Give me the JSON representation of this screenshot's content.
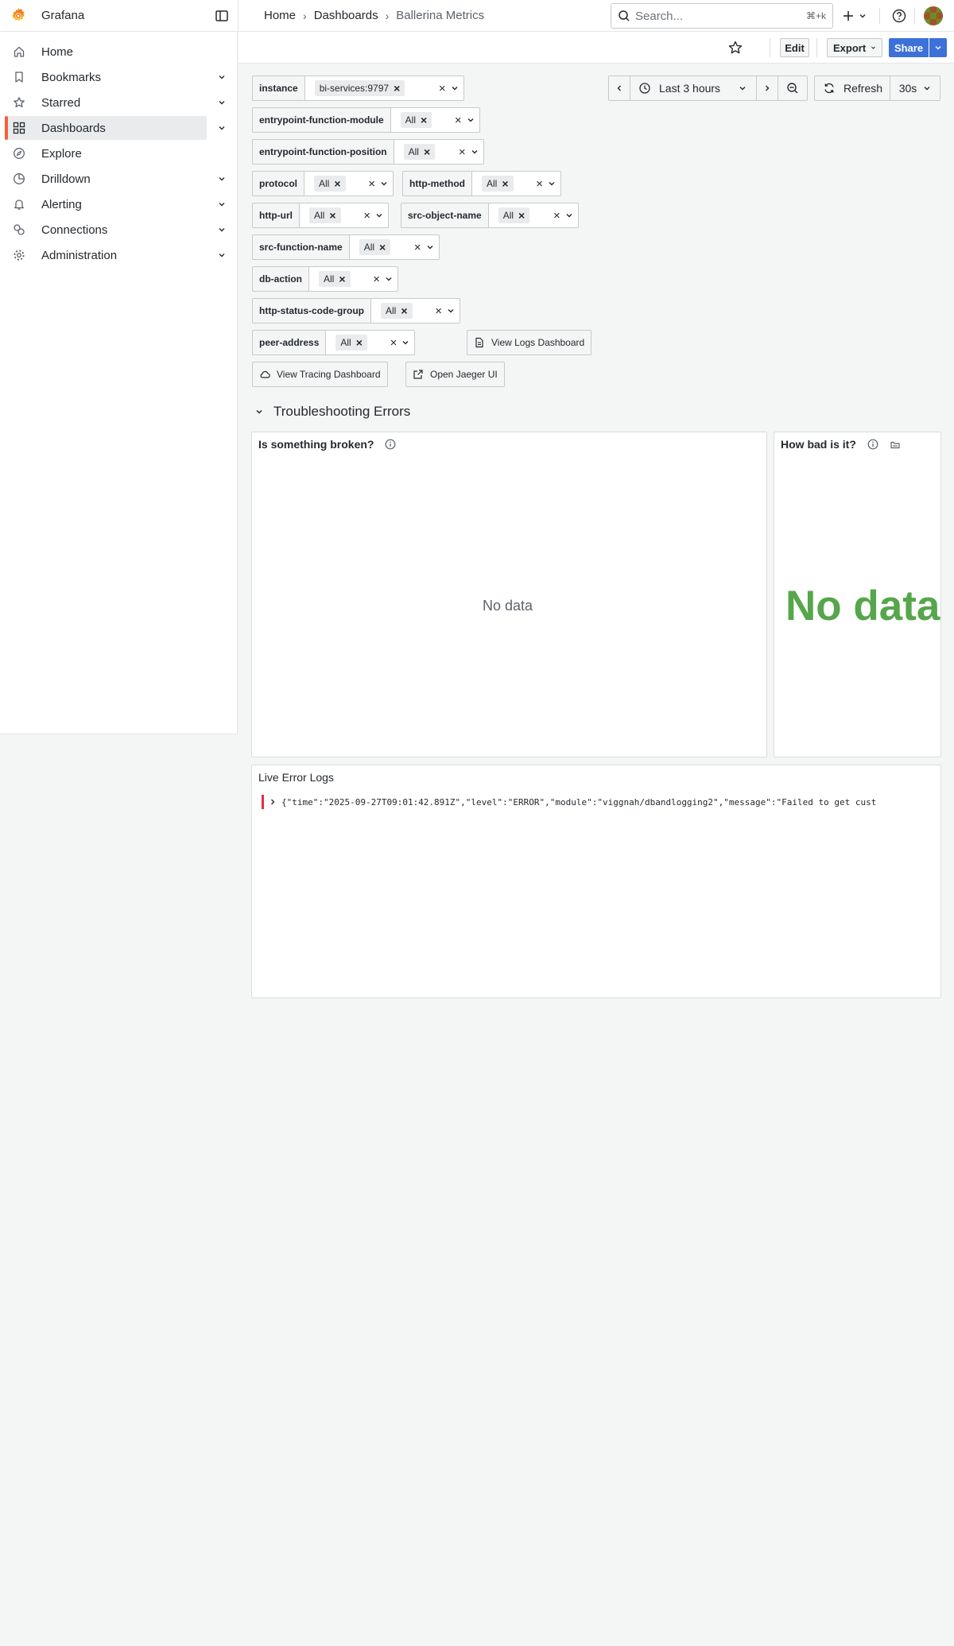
{
  "app": {
    "brand": "Grafana"
  },
  "breadcrumb": [
    "Home",
    "Dashboards",
    "Ballerina Metrics"
  ],
  "search": {
    "placeholder": "Search...",
    "shortcut": "⌘+k"
  },
  "toolbar": {
    "edit": "Edit",
    "export": "Export",
    "share": "Share"
  },
  "sidebar": {
    "items": [
      {
        "label": "Home",
        "icon": "home-icon"
      },
      {
        "label": "Bookmarks",
        "icon": "bookmark-icon"
      },
      {
        "label": "Starred",
        "icon": "star-icon"
      },
      {
        "label": "Dashboards",
        "icon": "apps-icon"
      },
      {
        "label": "Explore",
        "icon": "compass-icon"
      },
      {
        "label": "Drilldown",
        "icon": "drilldown-icon"
      },
      {
        "label": "Alerting",
        "icon": "bell-icon"
      },
      {
        "label": "Connections",
        "icon": "connections-icon"
      },
      {
        "label": "Administration",
        "icon": "cog-icon"
      }
    ]
  },
  "variables": [
    {
      "label": "instance",
      "value": "bi-services:9797"
    },
    {
      "label": "entrypoint-function-module",
      "value": "All"
    },
    {
      "label": "entrypoint-function-position",
      "value": "All"
    },
    {
      "label": "protocol",
      "value": "All"
    },
    {
      "label": "http-method",
      "value": "All"
    },
    {
      "label": "http-url",
      "value": "All"
    },
    {
      "label": "src-object-name",
      "value": "All"
    },
    {
      "label": "src-function-name",
      "value": "All"
    },
    {
      "label": "db-action",
      "value": "All"
    },
    {
      "label": "http-status-code-group",
      "value": "All"
    },
    {
      "label": "peer-address",
      "value": "All"
    }
  ],
  "links": {
    "logs": "View Logs Dashboard",
    "tracing": "View Tracing Dashboard",
    "jaeger": "Open Jaeger UI"
  },
  "timepicker": {
    "range": "Last 3 hours",
    "refresh": "Refresh",
    "interval": "30s"
  },
  "row": {
    "title": "Troubleshooting Errors"
  },
  "panels": {
    "broken": {
      "title": "Is something broken?",
      "no_data": "No data"
    },
    "how_bad": {
      "title": "How bad is it?",
      "no_data": "No data"
    },
    "logs": {
      "title": "Live Error Logs",
      "line": "{\"time\":\"2025-09-27T09:01:42.891Z\",\"level\":\"ERROR\",\"module\":\"viggnah/dbandlogging2\",\"message\":\"Failed to get cust"
    }
  },
  "colors": {
    "accent": "#3d71d9",
    "active_marker": "#f55f3e",
    "stat_green": "#56a64b",
    "log_error": "#e02f44"
  }
}
